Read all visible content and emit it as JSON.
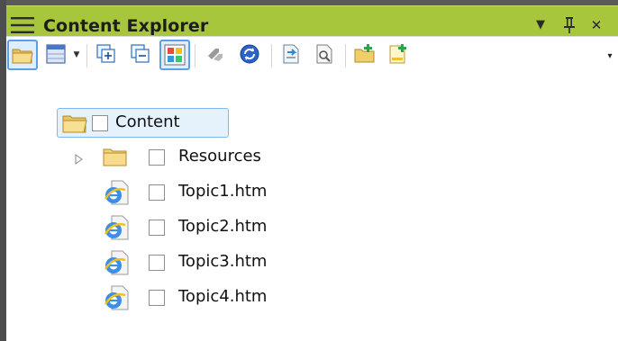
{
  "window": {
    "title": "Content Explorer",
    "buttons": {
      "dropdown_glyph": "▼",
      "pin_glyph": "ᛘ",
      "close_glyph": "✕"
    }
  },
  "toolbar": {
    "buttons": [
      {
        "name": "open-folder-icon",
        "state": "active"
      },
      {
        "name": "table-layout-icon",
        "state": "normal",
        "has_dropdown": true
      },
      {
        "name": "expand-all-icon",
        "state": "normal"
      },
      {
        "name": "collapse-all-icon",
        "state": "normal"
      },
      {
        "name": "color-grid-icon",
        "state": "active"
      },
      {
        "name": "link-icon",
        "state": "disabled"
      },
      {
        "name": "refresh-icon",
        "state": "normal"
      },
      {
        "name": "open-document-icon",
        "state": "normal"
      },
      {
        "name": "properties-icon",
        "state": "normal"
      },
      {
        "name": "new-folder-icon",
        "state": "normal"
      },
      {
        "name": "new-file-icon",
        "state": "normal"
      }
    ],
    "overflow_glyph": "▾"
  },
  "tree": {
    "root": {
      "label": "Content",
      "icon": "open-folder-icon",
      "selected": true
    },
    "children": [
      {
        "label": "Resources",
        "icon": "folder-icon",
        "expandable": true
      },
      {
        "label": "Topic1.htm",
        "icon": "ie-document-icon"
      },
      {
        "label": "Topic2.htm",
        "icon": "ie-document-icon"
      },
      {
        "label": "Topic3.htm",
        "icon": "ie-document-icon"
      },
      {
        "label": "Topic4.htm",
        "icon": "ie-document-icon"
      }
    ]
  },
  "colors": {
    "titlebar": "#a8c63c",
    "selection_border": "#7fb8ec",
    "selection_fill": "#e5f1fb",
    "folder": "#f3d27a"
  }
}
